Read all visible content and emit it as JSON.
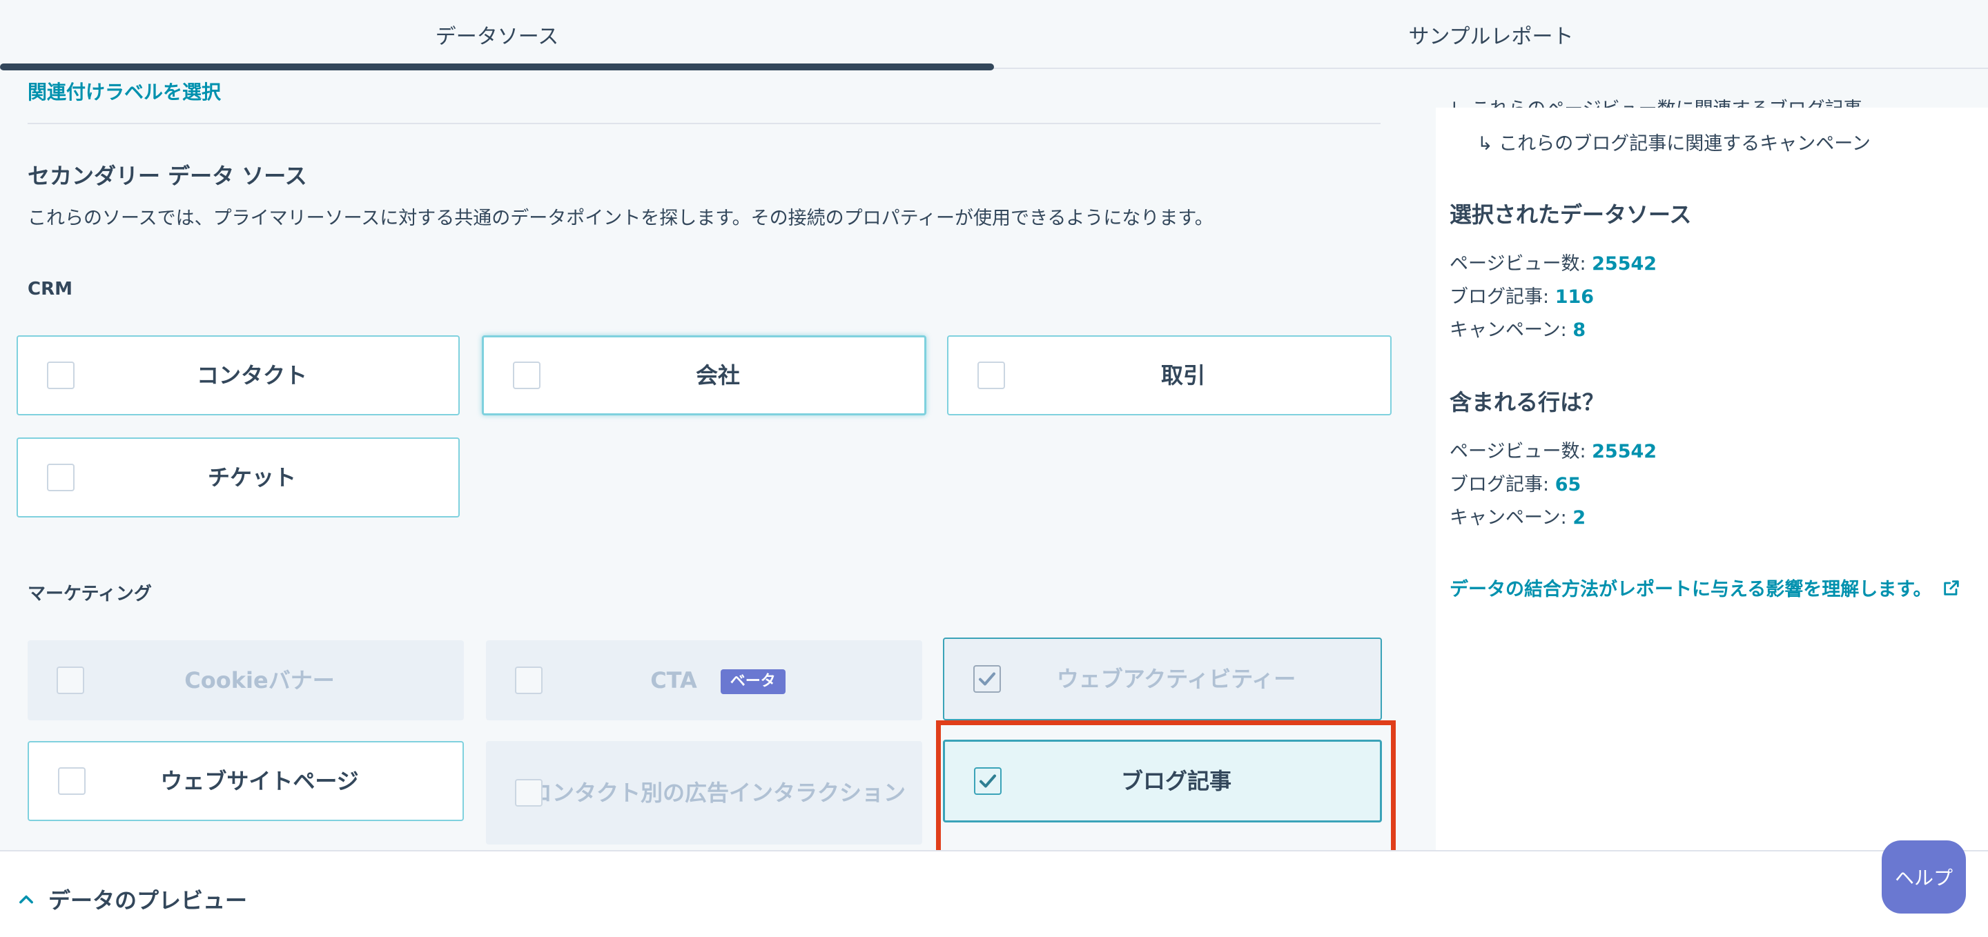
{
  "tabs": {
    "data_source": "データソース",
    "sample_report": "サンプルレポート"
  },
  "main": {
    "assoc_label_link": "関連付けラベルを選択",
    "secondary_title": "セカンダリー データ ソース",
    "secondary_desc": "これらのソースでは、プライマリーソースに対する共通のデータポイントを探します。その接続のプロパティーが使用できるようになります。",
    "crm": {
      "label": "CRM",
      "items": [
        "コンタクト",
        "会社",
        "取引",
        "チケット"
      ]
    },
    "marketing": {
      "label": "マーケティング",
      "items": [
        "Cookieバナー",
        "CTA",
        "ウェブアクティビティー",
        "ウェブサイトページ",
        "コンタクト別の広告インタラクション",
        "ブログ記事"
      ],
      "beta_badge": "ベータ"
    }
  },
  "side": {
    "truncated_line": "↳ これらのページビュー数に関連するブログ記事",
    "assoc_line": "↳ これらのブログ記事に関連するキャンペーン",
    "selected_title": "選択されたデータソース",
    "selected": [
      {
        "label": "ページビュー数: ",
        "value": "25542"
      },
      {
        "label": "ブログ記事: ",
        "value": "116"
      },
      {
        "label": "キャンペーン: ",
        "value": "8"
      }
    ],
    "rows_title": "含まれる行は？",
    "rows": [
      {
        "label": "ページビュー数: ",
        "value": "25542"
      },
      {
        "label": "ブログ記事: ",
        "value": "65"
      },
      {
        "label": "キャンペーン: ",
        "value": "2"
      }
    ],
    "learn_link": "データの結合方法がレポートに与える影響を理解します。"
  },
  "preview": {
    "label": "データのプレビュー"
  },
  "help": {
    "label": "ヘルプ"
  },
  "colors": {
    "accent": "#0091ae",
    "highlight": "#e03e1a",
    "help": "#6a78d1"
  },
  "icons": [
    "chevron-up-icon",
    "external-link-icon",
    "checkmark-icon"
  ]
}
